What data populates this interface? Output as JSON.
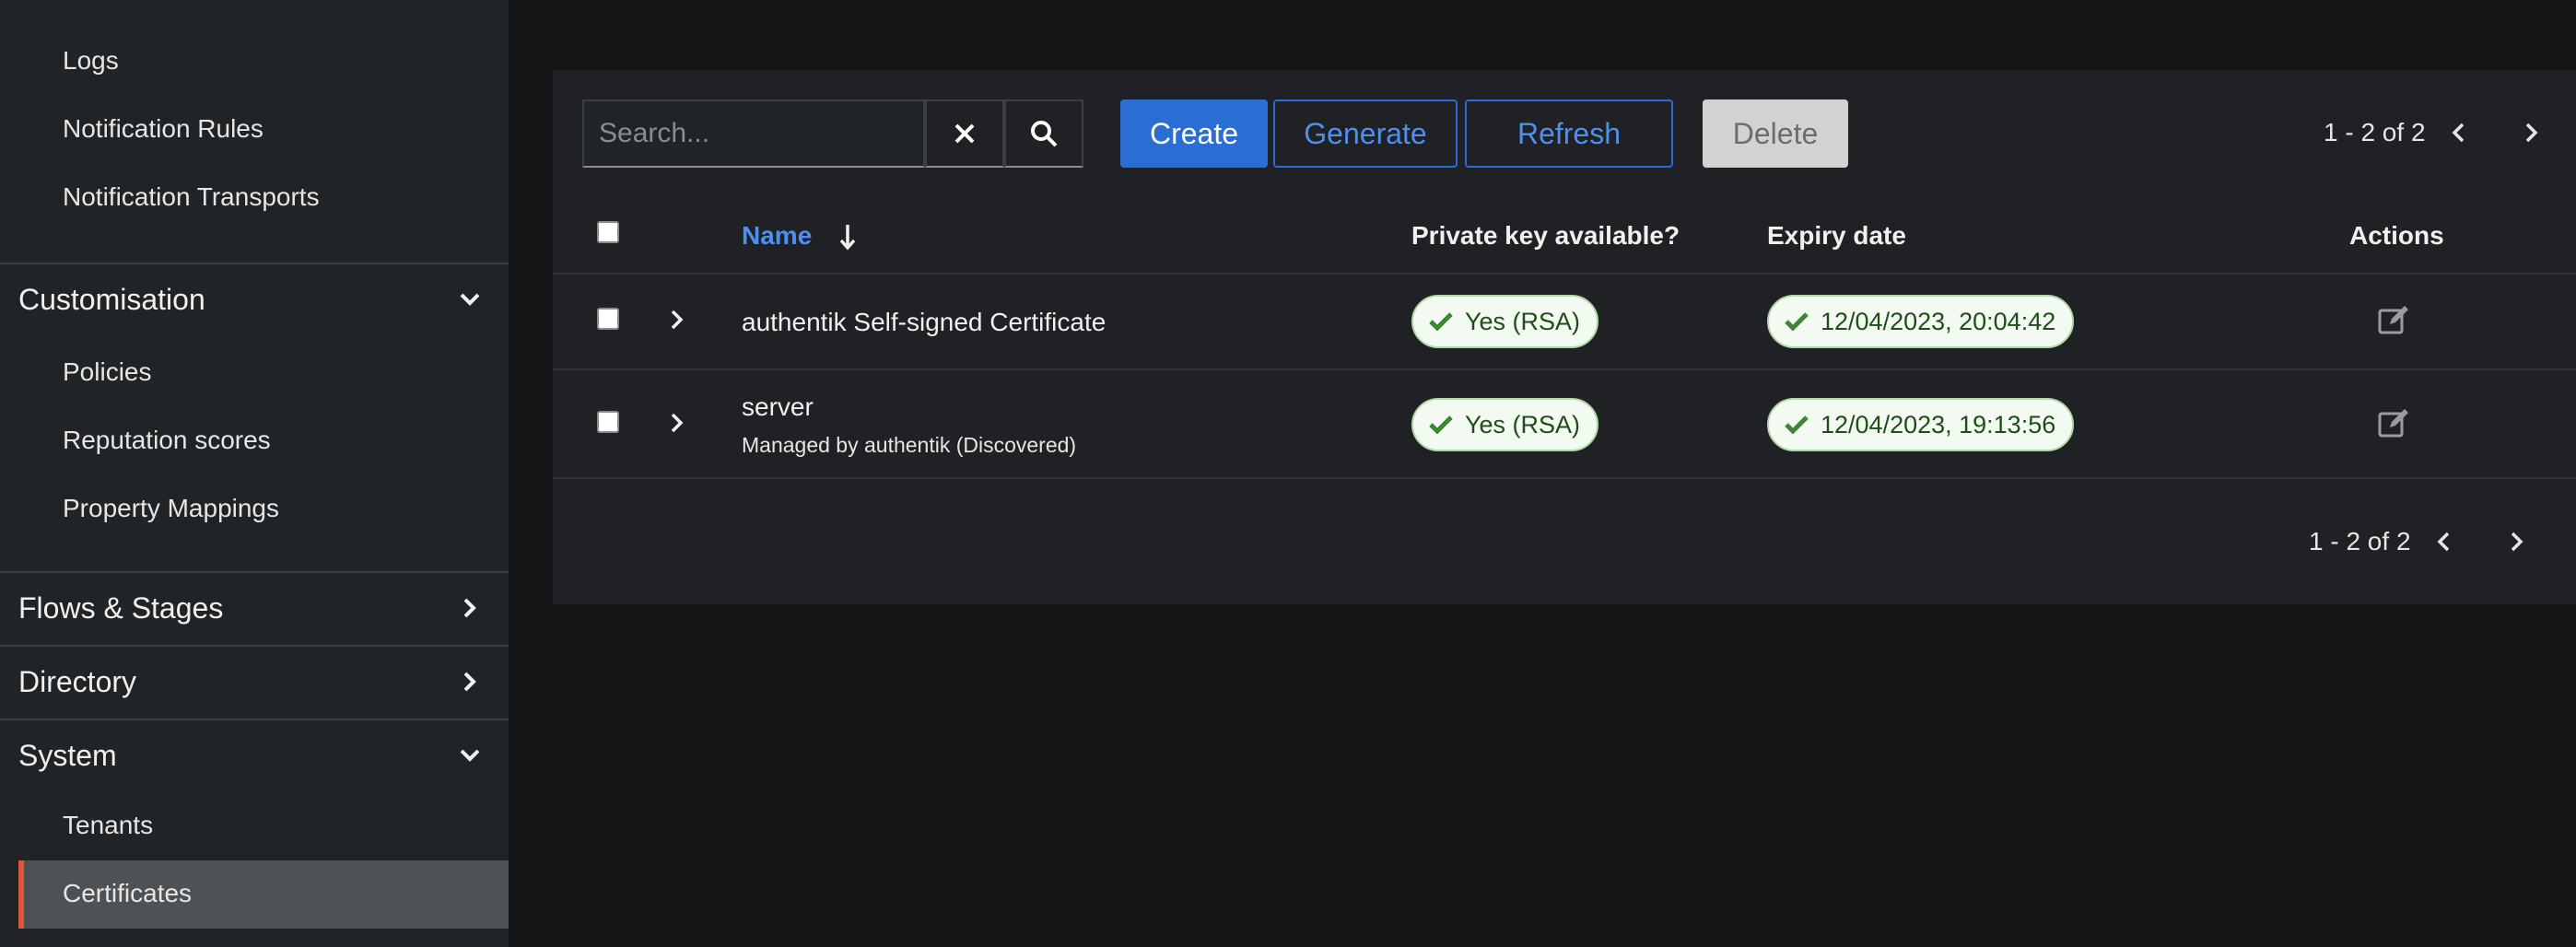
{
  "sidebar": {
    "sub_items_top": [
      "Logs",
      "Notification Rules",
      "Notification Transports"
    ],
    "groups": {
      "customisation": {
        "label": "Customisation",
        "items": [
          "Policies",
          "Reputation scores",
          "Property Mappings"
        ]
      },
      "flows": {
        "label": "Flows & Stages"
      },
      "directory": {
        "label": "Directory"
      },
      "system": {
        "label": "System",
        "items": [
          "Tenants",
          "Certificates"
        ]
      }
    },
    "active_item": "Certificates"
  },
  "toolbar": {
    "search_placeholder": "Search...",
    "create_label": "Create",
    "generate_label": "Generate",
    "refresh_label": "Refresh",
    "delete_label": "Delete",
    "pagination": "1 - 2 of 2"
  },
  "table": {
    "columns": {
      "name": "Name",
      "private_key": "Private key available?",
      "expiry": "Expiry date",
      "actions": "Actions"
    },
    "rows": [
      {
        "name": "authentik Self-signed Certificate",
        "subtitle": "",
        "private_key": "Yes (RSA)",
        "expiry": "12/04/2023, 20:04:42"
      },
      {
        "name": "server",
        "subtitle": "Managed by authentik (Discovered)",
        "private_key": "Yes (RSA)",
        "expiry": "12/04/2023, 19:13:56"
      }
    ]
  },
  "footer": {
    "pagination": "1 - 2 of 2"
  },
  "colors": {
    "accent": "#2a6ed3",
    "active_marker": "#e0533d",
    "success": "#3e8635"
  }
}
